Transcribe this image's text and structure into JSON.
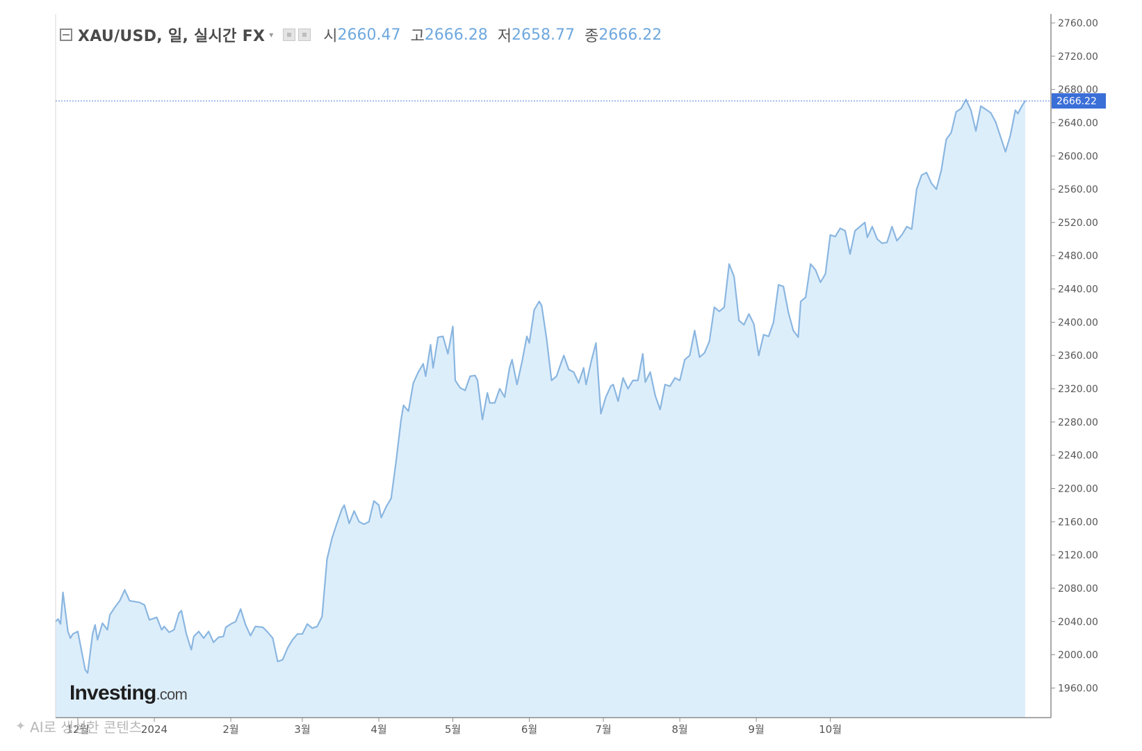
{
  "legend": {
    "symbol": "XAU/USD, 일, 실시간 FX",
    "open_label": "시",
    "open_value": "2660.47",
    "high_label": "고",
    "high_value": "2666.28",
    "low_label": "저",
    "low_value": "2658.77",
    "close_label": "종",
    "close_value": "2666.22"
  },
  "watermark": {
    "brand": "Investing",
    "suffix": ".com"
  },
  "caption": "AI로 생성한 콘텐츠",
  "chart_data": {
    "type": "area",
    "title": "",
    "xlabel": "",
    "ylabel": "",
    "ylim": [
      1930,
      2775
    ],
    "y_ticks": [
      1960,
      2000,
      2040,
      2080,
      2120,
      2160,
      2200,
      2240,
      2280,
      2320,
      2360,
      2400,
      2440,
      2480,
      2520,
      2560,
      2600,
      2640,
      2680,
      2720,
      2760
    ],
    "y_tick_labels": [
      "1960.00",
      "2000.00",
      "2040.00",
      "2080.00",
      "2120.00",
      "2160.00",
      "2200.00",
      "2240.00",
      "2280.00",
      "2320.00",
      "2360.00",
      "2400.00",
      "2440.00",
      "2480.00",
      "2520.00",
      "2560.00",
      "2600.00",
      "2640.00",
      "2680.00",
      "2720.00",
      "2760.00"
    ],
    "x_ticks": [
      {
        "label": "12월",
        "date": "2023-12-01"
      },
      {
        "label": "2024",
        "date": "2024-01-01"
      },
      {
        "label": "2월",
        "date": "2024-02-01"
      },
      {
        "label": "3월",
        "date": "2024-03-01"
      },
      {
        "label": "4월",
        "date": "2024-04-01"
      },
      {
        "label": "5월",
        "date": "2024-05-01"
      },
      {
        "label": "6월",
        "date": "2024-06-01"
      },
      {
        "label": "7월",
        "date": "2024-07-01"
      },
      {
        "label": "8월",
        "date": "2024-08-01"
      },
      {
        "label": "9월",
        "date": "2024-09-01"
      },
      {
        "label": "10월",
        "date": "2024-10-01"
      }
    ],
    "last_price": 2666.22,
    "last_price_label": "2666.22",
    "line_color": "#8ab6e0",
    "fill_color": "#ddeefb",
    "price_tag_color": "#3b6fd8",
    "grid": false,
    "series": [
      {
        "points": [
          [
            "2023-11-22",
            2040
          ],
          [
            "2023-11-23",
            2043
          ],
          [
            "2023-11-24",
            2037
          ],
          [
            "2023-11-25",
            2075
          ],
          [
            "2023-11-27",
            2028
          ],
          [
            "2023-11-28",
            2020
          ],
          [
            "2023-11-29",
            2025
          ],
          [
            "2023-12-01",
            2028
          ],
          [
            "2023-12-04",
            1982
          ],
          [
            "2023-12-05",
            1978
          ],
          [
            "2023-12-07",
            2025
          ],
          [
            "2023-12-08",
            2036
          ],
          [
            "2023-12-09",
            2018
          ],
          [
            "2023-12-11",
            2038
          ],
          [
            "2023-12-13",
            2030
          ],
          [
            "2023-12-14",
            2048
          ],
          [
            "2023-12-16",
            2057
          ],
          [
            "2023-12-18",
            2065
          ],
          [
            "2023-12-20",
            2078
          ],
          [
            "2023-12-22",
            2065
          ],
          [
            "2023-12-26",
            2063
          ],
          [
            "2023-12-28",
            2060
          ],
          [
            "2023-12-30",
            2042
          ],
          [
            "2024-01-02",
            2045
          ],
          [
            "2024-01-04",
            2030
          ],
          [
            "2024-01-05",
            2034
          ],
          [
            "2024-01-07",
            2027
          ],
          [
            "2024-01-09",
            2030
          ],
          [
            "2024-01-11",
            2050
          ],
          [
            "2024-01-12",
            2053
          ],
          [
            "2024-01-14",
            2025
          ],
          [
            "2024-01-16",
            2006
          ],
          [
            "2024-01-17",
            2022
          ],
          [
            "2024-01-19",
            2028
          ],
          [
            "2024-01-21",
            2020
          ],
          [
            "2024-01-23",
            2028
          ],
          [
            "2024-01-25",
            2015
          ],
          [
            "2024-01-27",
            2021
          ],
          [
            "2024-01-29",
            2022
          ],
          [
            "2024-01-30",
            2033
          ],
          [
            "2024-02-01",
            2037
          ],
          [
            "2024-02-03",
            2040
          ],
          [
            "2024-02-05",
            2055
          ],
          [
            "2024-02-07",
            2036
          ],
          [
            "2024-02-09",
            2023
          ],
          [
            "2024-02-11",
            2034
          ],
          [
            "2024-02-14",
            2033
          ],
          [
            "2024-02-16",
            2027
          ],
          [
            "2024-02-18",
            2020
          ],
          [
            "2024-02-20",
            1992
          ],
          [
            "2024-02-22",
            1994
          ],
          [
            "2024-02-24",
            2008
          ],
          [
            "2024-02-26",
            2018
          ],
          [
            "2024-02-28",
            2025
          ],
          [
            "2024-03-01",
            2025
          ],
          [
            "2024-03-03",
            2037
          ],
          [
            "2024-03-05",
            2032
          ],
          [
            "2024-03-07",
            2034
          ],
          [
            "2024-03-09",
            2046
          ],
          [
            "2024-03-11",
            2115
          ],
          [
            "2024-03-13",
            2140
          ],
          [
            "2024-03-15",
            2158
          ],
          [
            "2024-03-17",
            2175
          ],
          [
            "2024-03-18",
            2180
          ],
          [
            "2024-03-20",
            2158
          ],
          [
            "2024-03-22",
            2173
          ],
          [
            "2024-03-24",
            2160
          ],
          [
            "2024-03-26",
            2157
          ],
          [
            "2024-03-28",
            2160
          ],
          [
            "2024-03-30",
            2185
          ],
          [
            "2024-04-01",
            2180
          ],
          [
            "2024-04-02",
            2165
          ],
          [
            "2024-04-04",
            2178
          ],
          [
            "2024-04-06",
            2188
          ],
          [
            "2024-04-08",
            2232
          ],
          [
            "2024-04-10",
            2282
          ],
          [
            "2024-04-11",
            2300
          ],
          [
            "2024-04-13",
            2293
          ],
          [
            "2024-04-15",
            2327
          ],
          [
            "2024-04-17",
            2340
          ],
          [
            "2024-04-19",
            2350
          ],
          [
            "2024-04-20",
            2335
          ],
          [
            "2024-04-22",
            2373
          ],
          [
            "2024-04-23",
            2345
          ],
          [
            "2024-04-25",
            2382
          ],
          [
            "2024-04-27",
            2383
          ],
          [
            "2024-04-29",
            2362
          ],
          [
            "2024-05-01",
            2395
          ],
          [
            "2024-05-02",
            2330
          ],
          [
            "2024-05-04",
            2321
          ],
          [
            "2024-05-06",
            2318
          ],
          [
            "2024-05-08",
            2335
          ],
          [
            "2024-05-10",
            2336
          ],
          [
            "2024-05-11",
            2330
          ],
          [
            "2024-05-13",
            2283
          ],
          [
            "2024-05-15",
            2315
          ],
          [
            "2024-05-16",
            2303
          ],
          [
            "2024-05-18",
            2303
          ],
          [
            "2024-05-20",
            2320
          ],
          [
            "2024-05-22",
            2310
          ],
          [
            "2024-05-24",
            2345
          ],
          [
            "2024-05-25",
            2355
          ],
          [
            "2024-05-27",
            2325
          ],
          [
            "2024-05-29",
            2352
          ],
          [
            "2024-05-31",
            2383
          ],
          [
            "2024-06-01",
            2375
          ],
          [
            "2024-06-03",
            2415
          ],
          [
            "2024-06-05",
            2425
          ],
          [
            "2024-06-06",
            2420
          ],
          [
            "2024-06-08",
            2380
          ],
          [
            "2024-06-10",
            2330
          ],
          [
            "2024-06-12",
            2335
          ],
          [
            "2024-06-14",
            2352
          ],
          [
            "2024-06-15",
            2360
          ],
          [
            "2024-06-17",
            2343
          ],
          [
            "2024-06-19",
            2340
          ],
          [
            "2024-06-21",
            2327
          ],
          [
            "2024-06-23",
            2345
          ],
          [
            "2024-06-24",
            2325
          ],
          [
            "2024-06-26",
            2352
          ],
          [
            "2024-06-28",
            2375
          ],
          [
            "2024-06-30",
            2290
          ],
          [
            "2024-07-02",
            2310
          ],
          [
            "2024-07-04",
            2323
          ],
          [
            "2024-07-05",
            2325
          ],
          [
            "2024-07-07",
            2305
          ],
          [
            "2024-07-09",
            2333
          ],
          [
            "2024-07-11",
            2320
          ],
          [
            "2024-07-13",
            2330
          ],
          [
            "2024-07-15",
            2330
          ],
          [
            "2024-07-17",
            2362
          ],
          [
            "2024-07-18",
            2328
          ],
          [
            "2024-07-20",
            2340
          ],
          [
            "2024-07-22",
            2312
          ],
          [
            "2024-07-24",
            2295
          ],
          [
            "2024-07-26",
            2325
          ],
          [
            "2024-07-28",
            2323
          ],
          [
            "2024-07-30",
            2333
          ],
          [
            "2024-08-01",
            2330
          ],
          [
            "2024-08-03",
            2355
          ],
          [
            "2024-08-05",
            2360
          ],
          [
            "2024-08-07",
            2390
          ],
          [
            "2024-08-09",
            2358
          ],
          [
            "2024-08-11",
            2363
          ],
          [
            "2024-08-13",
            2377
          ],
          [
            "2024-08-15",
            2418
          ],
          [
            "2024-08-17",
            2413
          ],
          [
            "2024-08-19",
            2418
          ],
          [
            "2024-08-21",
            2470
          ],
          [
            "2024-08-23",
            2455
          ],
          [
            "2024-08-25",
            2402
          ],
          [
            "2024-08-27",
            2397
          ],
          [
            "2024-08-29",
            2410
          ],
          [
            "2024-08-31",
            2398
          ],
          [
            "2024-09-02",
            2360
          ],
          [
            "2024-09-04",
            2385
          ],
          [
            "2024-09-06",
            2383
          ],
          [
            "2024-09-08",
            2400
          ],
          [
            "2024-09-10",
            2445
          ],
          [
            "2024-09-12",
            2443
          ],
          [
            "2024-09-14",
            2412
          ],
          [
            "2024-09-16",
            2390
          ],
          [
            "2024-09-18",
            2382
          ],
          [
            "2024-09-19",
            2425
          ],
          [
            "2024-09-21",
            2430
          ],
          [
            "2024-09-23",
            2470
          ],
          [
            "2024-09-25",
            2463
          ],
          [
            "2024-09-27",
            2448
          ],
          [
            "2024-09-29",
            2458
          ],
          [
            "2024-10-01",
            2505
          ],
          [
            "2024-10-03",
            2503
          ],
          [
            "2024-10-05",
            2513
          ],
          [
            "2024-10-07",
            2510
          ],
          [
            "2024-10-09",
            2482
          ],
          [
            "2024-10-11",
            2510
          ],
          [
            "2024-10-13",
            2515
          ],
          [
            "2024-10-15",
            2520
          ],
          [
            "2024-10-16",
            2502
          ],
          [
            "2024-10-18",
            2515
          ],
          [
            "2024-10-20",
            2500
          ],
          [
            "2024-10-22",
            2495
          ],
          [
            "2024-10-24",
            2496
          ],
          [
            "2024-10-26",
            2515
          ],
          [
            "2024-10-28",
            2498
          ],
          [
            "2024-10-30",
            2505
          ],
          [
            "2024-11-01",
            2515
          ],
          [
            "2024-11-03",
            2512
          ],
          [
            "2024-11-05",
            2560
          ],
          [
            "2024-11-07",
            2577
          ],
          [
            "2024-11-09",
            2580
          ],
          [
            "2024-11-11",
            2567
          ],
          [
            "2024-11-13",
            2560
          ],
          [
            "2024-11-15",
            2583
          ],
          [
            "2024-11-17",
            2620
          ],
          [
            "2024-11-19",
            2628
          ],
          [
            "2024-11-21",
            2653
          ],
          [
            "2024-11-23",
            2657
          ],
          [
            "2024-11-25",
            2668
          ],
          [
            "2024-11-27",
            2655
          ],
          [
            "2024-11-29",
            2630
          ],
          [
            "2024-12-01",
            2660
          ],
          [
            "2024-12-03",
            2656
          ],
          [
            "2024-12-05",
            2652
          ],
          [
            "2024-12-07",
            2641
          ],
          [
            "2024-12-09",
            2623
          ],
          [
            "2024-12-11",
            2605
          ],
          [
            "2024-12-13",
            2625
          ],
          [
            "2024-12-15",
            2655
          ],
          [
            "2024-12-16",
            2651
          ],
          [
            "2024-12-18",
            2662
          ],
          [
            "2024-12-19",
            2666.22
          ]
        ]
      }
    ]
  }
}
